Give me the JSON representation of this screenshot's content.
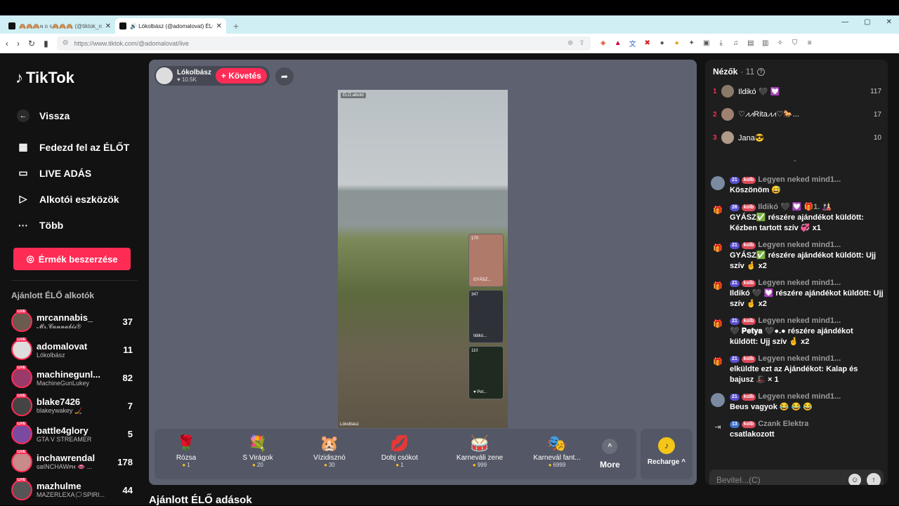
{
  "browser": {
    "tabs": [
      {
        "label": "🙈🙈🙈ɴ ᴏ ꜱ🙈🙈🙈 (@tiktok_rol..."
      },
      {
        "label": "🔊 Lókolbász (@adomalovat) ÉLŐ"
      }
    ],
    "new_tab": "+",
    "url": "https://www.tiktok.com/@adomalovat/live"
  },
  "sidebar": {
    "logo": "TikTok",
    "back": "Vissza",
    "nav": [
      {
        "label": "Fedezd fel az ÉLŐT",
        "icon": "calendar-icon"
      },
      {
        "label": "LIVE ADÁS",
        "icon": "camera-icon"
      },
      {
        "label": "Alkotói eszközök",
        "icon": "play-icon"
      },
      {
        "label": "Több",
        "icon": "more-icon"
      }
    ],
    "coins_btn": "Érmék beszerzése",
    "section_title": "Ajánlott ÉLŐ alkotók",
    "creators": [
      {
        "name": "mrcannabis_",
        "sub": "𝓜𝓻.𝓒𝓪𝓷𝓷𝓪𝓫𝓲𝓼®",
        "count": "37"
      },
      {
        "name": "adomalovat",
        "sub": "Lókolbász",
        "count": "11"
      },
      {
        "name": "machinegunl...",
        "sub": "MachineGunLukey",
        "count": "82"
      },
      {
        "name": "blake7426",
        "sub": "blakeywakey 🏒",
        "count": "7"
      },
      {
        "name": "battle4glory",
        "sub": "GTA V STREAMER",
        "count": "5"
      },
      {
        "name": "inchawrendal",
        "sub": "ɢʙINCHAWᴘʜ 👄 ...",
        "count": "178"
      },
      {
        "name": "mazhulme",
        "sub": "MAZERLEXA🗯SPIRI...",
        "count": "44"
      }
    ],
    "live_badge": "LIVE"
  },
  "stage": {
    "host_name": "Lókolbász",
    "host_likes": "♥ 10.5K",
    "follow": "+ Követés",
    "video_tag": "ÉLŐ alkotó",
    "watermark": "Lókolbász",
    "guests": [
      {
        "count": "170",
        "name": "GYÁSZ..."
      },
      {
        "count": "347",
        "name": "Ildikó..."
      },
      {
        "count": "110",
        "name": "♥ Pet..."
      }
    ],
    "gifts": [
      {
        "name": "Rózsa",
        "price": "1",
        "icon": "🌹"
      },
      {
        "name": "S Virágok",
        "price": "20",
        "icon": "💐"
      },
      {
        "name": "Vízidisznó",
        "price": "30",
        "icon": "🐹"
      },
      {
        "name": "Dobj csókot",
        "price": "1",
        "icon": "💋"
      },
      {
        "name": "Karneváli zene",
        "price": "999",
        "icon": "🥁"
      },
      {
        "name": "Karnevál fant...",
        "price": "6999",
        "icon": "🎭"
      }
    ],
    "more": "More",
    "recharge": "Recharge ^"
  },
  "recommended_title": "Ajánlott ÉLŐ adások",
  "chat": {
    "viewers_label": "Nézők",
    "viewers_count": "· 11",
    "top_viewers": [
      {
        "rank": "1",
        "name": "Ildikó 🖤 💟",
        "score": "117"
      },
      {
        "rank": "2",
        "name": "♡⩘⩘Rita⩘⩘♡🐎...",
        "score": "17"
      },
      {
        "rank": "3",
        "name": "Jana😎",
        "score": "10"
      }
    ],
    "messages": [
      {
        "icon": "avatar",
        "badges": [
          "21",
          "kolb"
        ],
        "user": "Legyen neked mind1...",
        "text": "Köszönöm 😅"
      },
      {
        "icon": "gift-icon",
        "badges": [
          "26",
          "kolb"
        ],
        "user": "Ildikó 🖤 💟 🎁1. 🎎",
        "text": "GYÁSZ✅ részére ajándékot küldött: Kézben tartott szív 💞 x1"
      },
      {
        "icon": "gift-icon",
        "badges": [
          "21",
          "kolb"
        ],
        "user": "Legyen neked mind1...",
        "text": "GYÁSZ✅ részére ajándékot küldött: Ujj szív 🤞 x2"
      },
      {
        "icon": "gift-icon",
        "badges": [
          "21",
          "kolb"
        ],
        "user": "Legyen neked mind1...",
        "text": "Ildikó 🖤 💟 részére ajándékot küldött: Ujj szív 🤞 x2"
      },
      {
        "icon": "gift-icon",
        "badges": [
          "21",
          "kolb"
        ],
        "user": "Legyen neked mind1...",
        "text": "🖤 𝐏𝐞𝐭𝐲𝐚 🖤●.● részére ajándékot küldött: Ujj szív 🤞 x2"
      },
      {
        "icon": "gift-icon",
        "badges": [
          "21",
          "kolb"
        ],
        "user": "Legyen neked mind1...",
        "text": "elküldte ezt az Ajándékot: Kalap és bajusz 🎩 × 1"
      },
      {
        "icon": "avatar",
        "badges": [
          "21",
          "kolb"
        ],
        "user": "Legyen neked mind1...",
        "text": "Beus vagyok 😂 😂 😂"
      },
      {
        "icon": "join-icon",
        "badges": [
          "13",
          "kolb"
        ],
        "user": "Czank Elektra",
        "text": "csatlakozott"
      }
    ],
    "input_placeholder": "Bevitel...(C)"
  },
  "colors": {
    "accent": "#fe2c55",
    "stage": "#5e6170",
    "panel": "#1e1e1e"
  }
}
